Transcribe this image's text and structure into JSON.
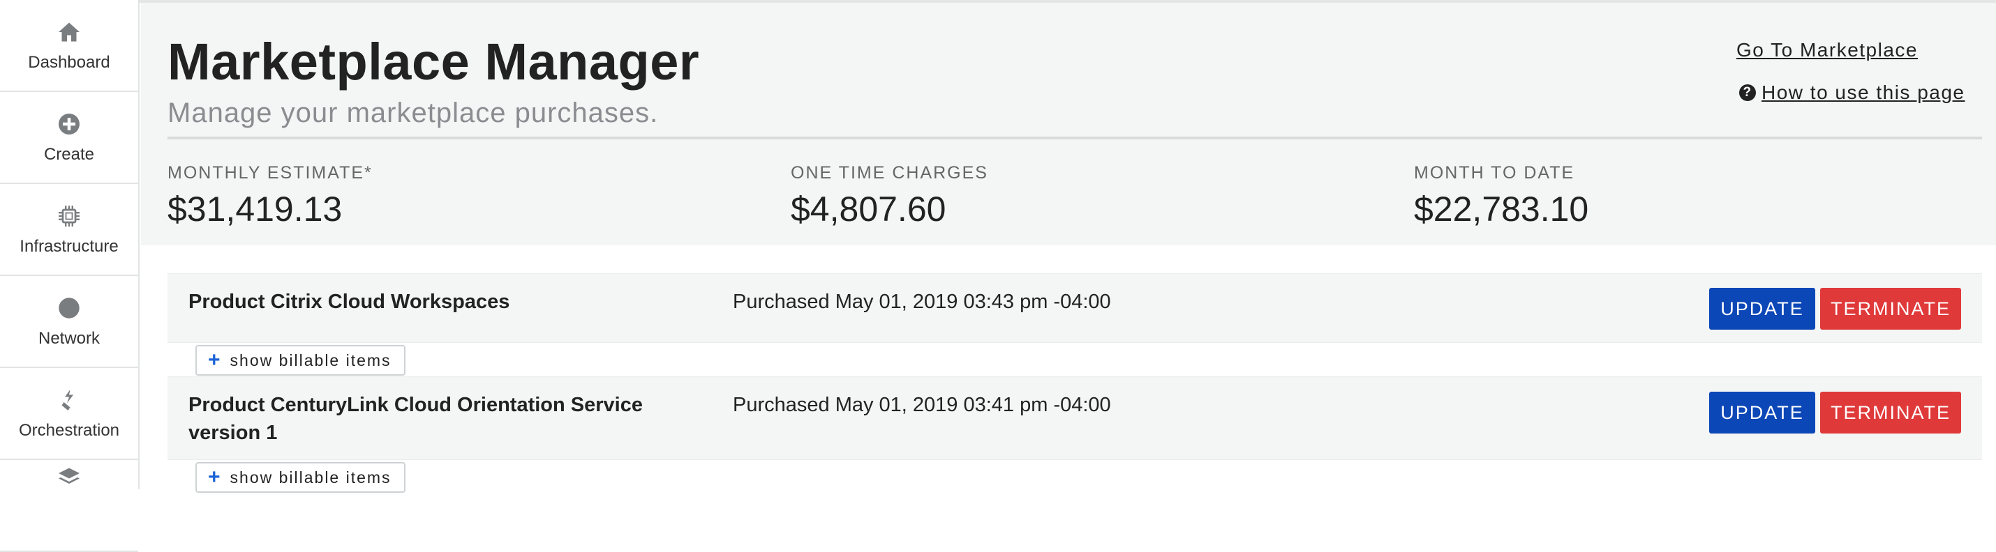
{
  "sidebar": {
    "items": [
      {
        "label": "Dashboard",
        "icon": "home-icon"
      },
      {
        "label": "Create",
        "icon": "plus-circle-icon"
      },
      {
        "label": "Infrastructure",
        "icon": "chip-icon"
      },
      {
        "label": "Network",
        "icon": "globe-icon"
      },
      {
        "label": "Orchestration",
        "icon": "orchestration-icon"
      },
      {
        "label": "",
        "icon": "layers-icon"
      }
    ]
  },
  "header": {
    "title": "Marketplace Manager",
    "subtitle": "Manage your marketplace purchases.",
    "links": {
      "marketplace": "Go To Marketplace",
      "howto": " How to use this page"
    }
  },
  "stats": {
    "monthly_label": "MONTHLY ESTIMATE*",
    "monthly_value": "$31,419.13",
    "onetime_label": "ONE TIME CHARGES",
    "onetime_value": "$4,807.60",
    "mtd_label": "MONTH TO DATE",
    "mtd_value": "$22,783.10"
  },
  "products": [
    {
      "name": "Product Citrix Cloud Workspaces",
      "purchased": "Purchased May 01, 2019 03:43 pm -04:00",
      "update_label": "UPDATE",
      "terminate_label": "TERMINATE",
      "show_label": "show billable items"
    },
    {
      "name": "Product CenturyLink Cloud Orientation Service version 1",
      "purchased": "Purchased May 01, 2019 03:41 pm -04:00",
      "update_label": "UPDATE",
      "terminate_label": "TERMINATE",
      "show_label": "show billable items"
    }
  ],
  "colors": {
    "update": "#0c47b7",
    "terminate": "#e0393a",
    "accent_plus": "#1b63d8",
    "header_bg": "#f4f5f5"
  }
}
